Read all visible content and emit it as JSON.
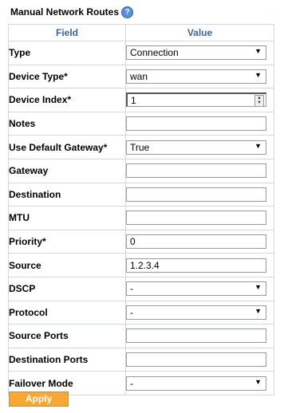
{
  "header": {
    "title": "Manual Network Routes",
    "help_glyph": "?"
  },
  "table": {
    "col_field": "Field",
    "col_value": "Value",
    "rows": [
      {
        "label": "Type",
        "value": "Connection",
        "control": "select"
      },
      {
        "label": "Device Type*",
        "value": "wan",
        "control": "select"
      },
      {
        "label": "Device Index*",
        "value": "1",
        "control": "number"
      },
      {
        "label": "Notes",
        "value": "",
        "control": "text"
      },
      {
        "label": "Use Default Gateway*",
        "value": "True",
        "control": "select"
      },
      {
        "label": "Gateway",
        "value": "",
        "control": "text"
      },
      {
        "label": "Destination",
        "value": "",
        "control": "text"
      },
      {
        "label": "MTU",
        "value": "",
        "control": "text"
      },
      {
        "label": "Priority*",
        "value": "0",
        "control": "text"
      },
      {
        "label": "Source",
        "value": "1.2.3.4",
        "control": "text"
      },
      {
        "label": "DSCP",
        "value": "-",
        "control": "select"
      },
      {
        "label": "Protocol",
        "value": "-",
        "control": "select"
      },
      {
        "label": "Source Ports",
        "value": "",
        "control": "text"
      },
      {
        "label": "Destination Ports",
        "value": "",
        "control": "text"
      },
      {
        "label": "Failover Mode",
        "value": "-",
        "control": "select"
      }
    ]
  },
  "apply_label": "Apply",
  "colors": {
    "header_text": "#3a63a8",
    "apply_bg": "#f7a833",
    "help_icon": "#5b8fd8"
  }
}
